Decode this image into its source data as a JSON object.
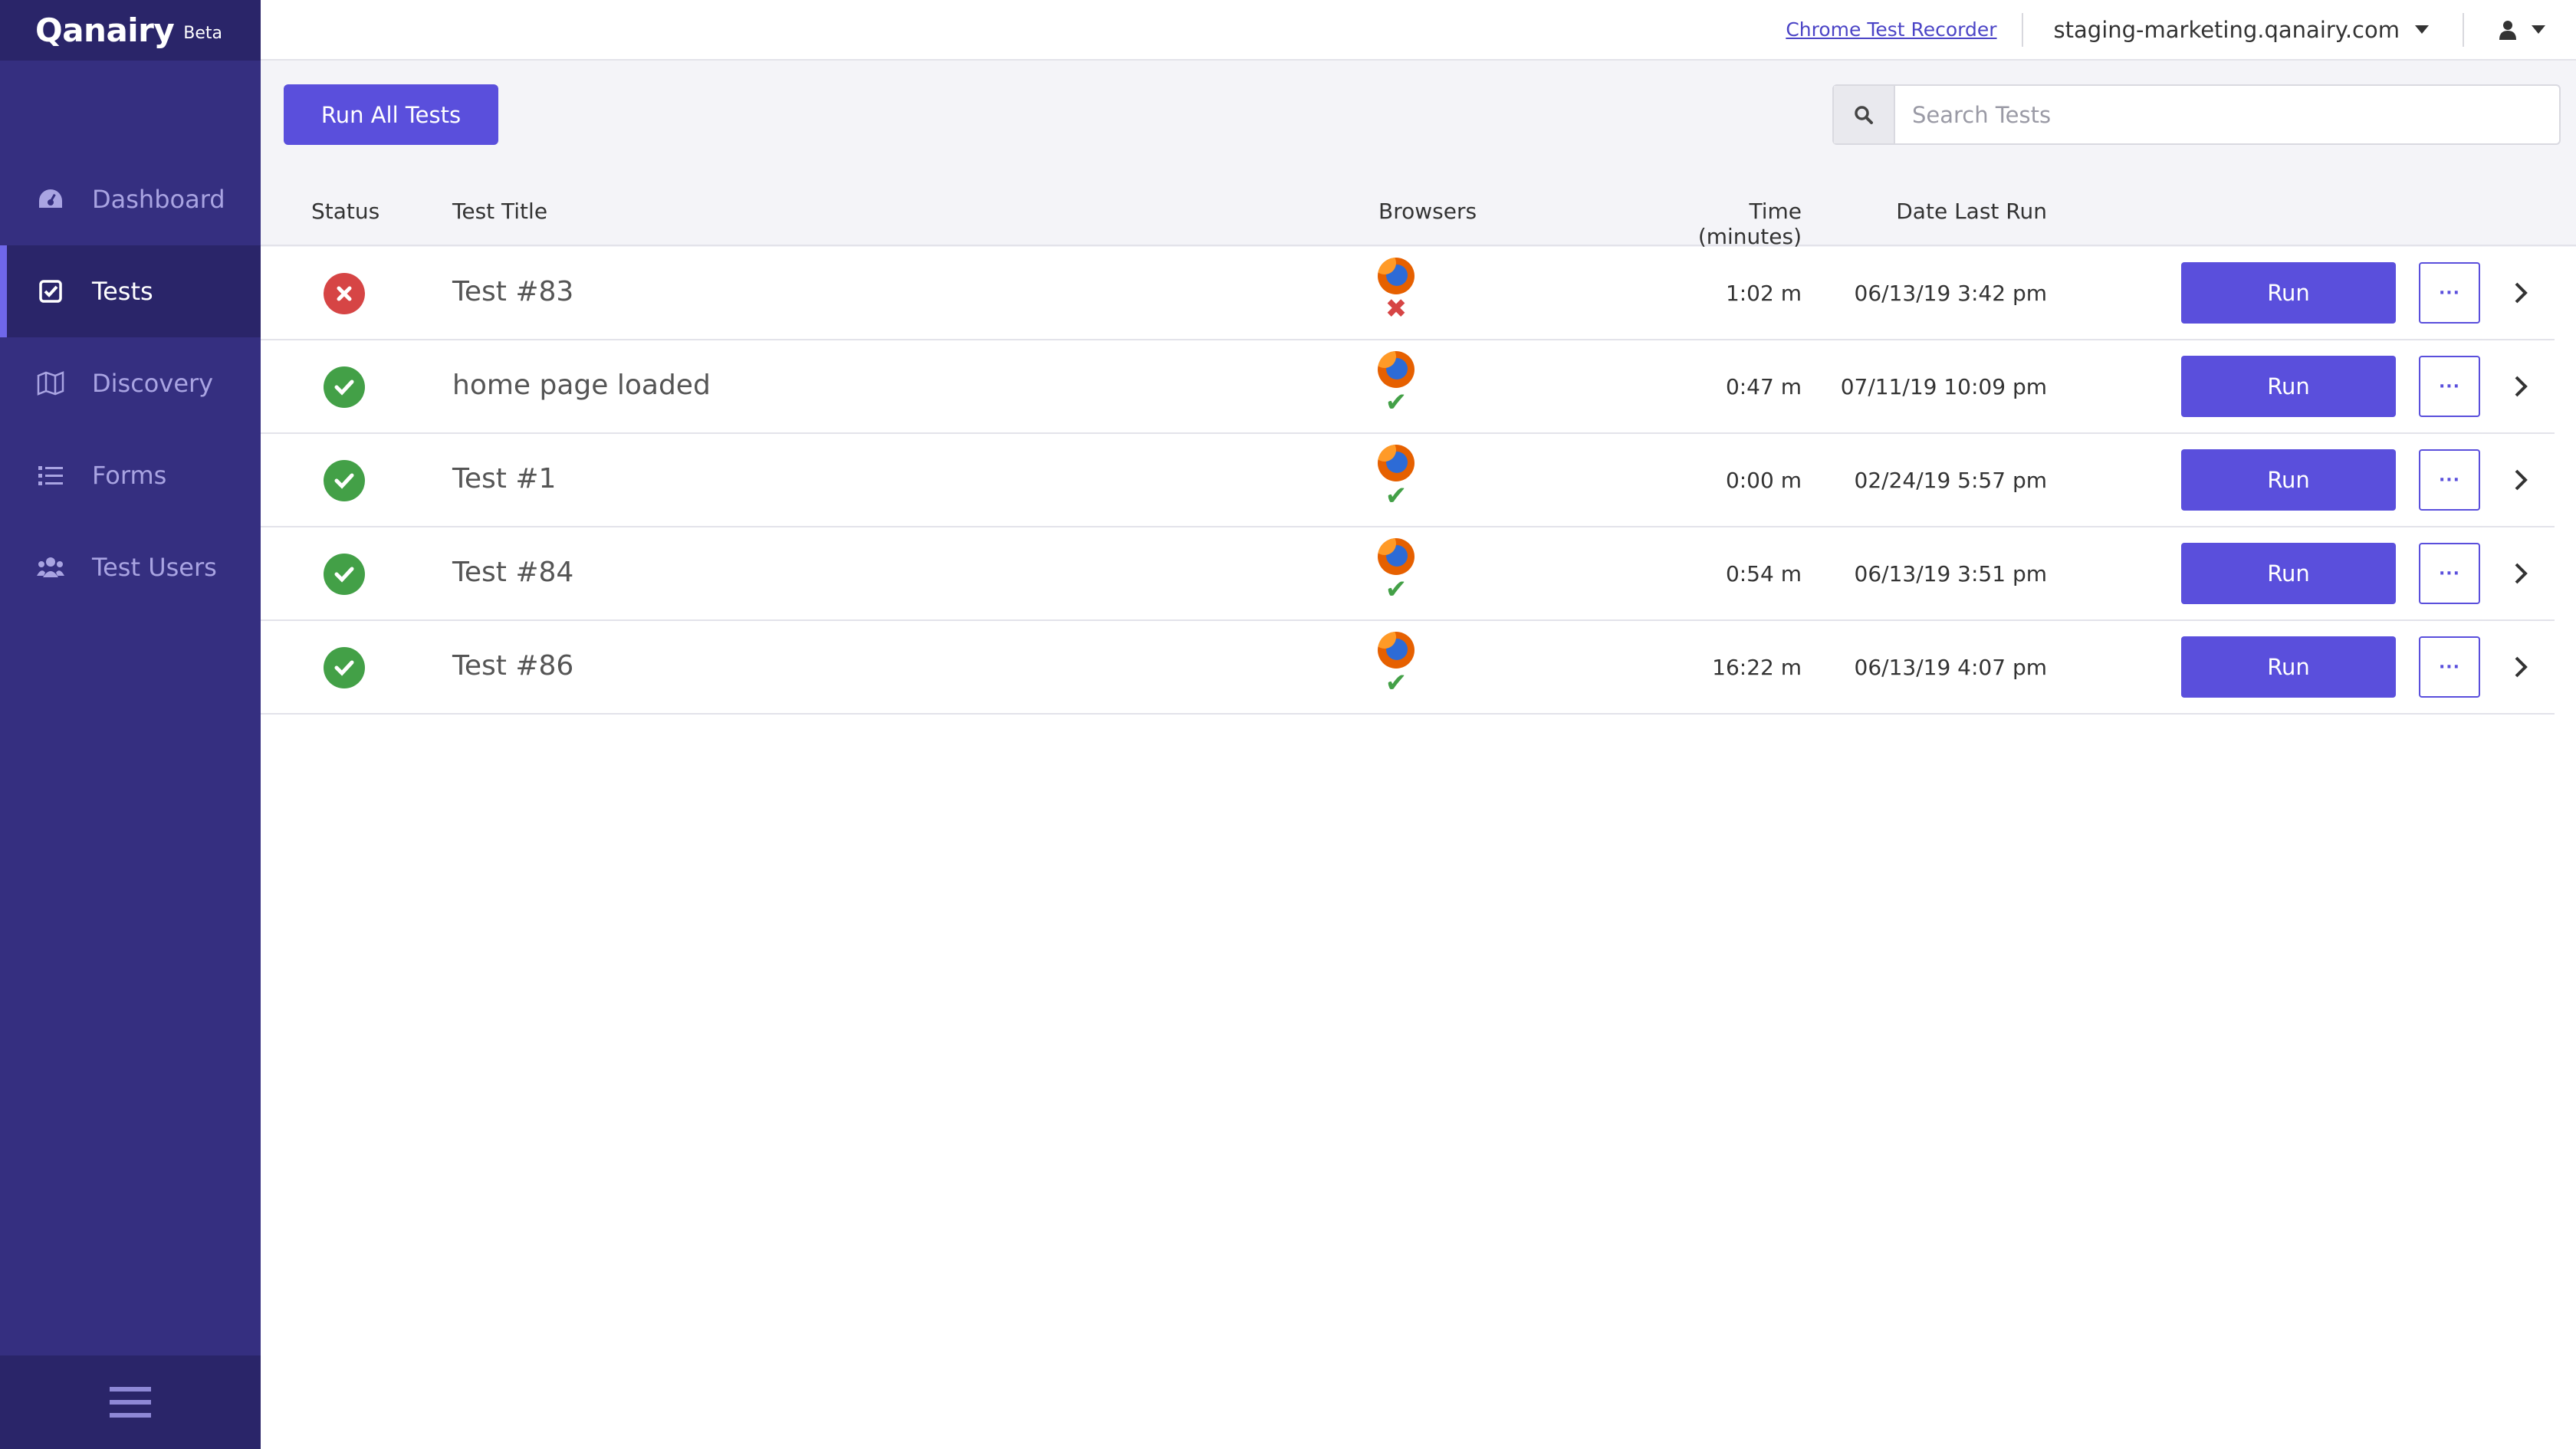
{
  "brand": {
    "name": "Qanairy",
    "badge": "Beta"
  },
  "sidebar": {
    "items": [
      {
        "label": "Dashboard",
        "icon": "dashboard-icon",
        "active": false
      },
      {
        "label": "Tests",
        "icon": "checkbox-icon",
        "active": true
      },
      {
        "label": "Discovery",
        "icon": "map-icon",
        "active": false
      },
      {
        "label": "Forms",
        "icon": "list-icon",
        "active": false
      },
      {
        "label": "Test Users",
        "icon": "users-icon",
        "active": false
      }
    ],
    "footer_icon": "hamburger-menu-icon"
  },
  "topbar": {
    "recorder_link": "Chrome Test Recorder",
    "environment": "staging-marketing.qanairy.com",
    "user_icon": "user-icon"
  },
  "toolbar": {
    "run_all_label": "Run All Tests",
    "search_placeholder": "Search Tests",
    "search_value": ""
  },
  "table": {
    "headers": {
      "status": "Status",
      "title": "Test Title",
      "browsers": "Browsers",
      "time": "Time (minutes)",
      "date": "Date Last Run"
    },
    "rows": [
      {
        "status": "fail",
        "title": "Test #83",
        "browser": "firefox",
        "browser_status": "fail",
        "time": "1:02 m",
        "date": "06/13/19 3:42 pm",
        "run_label": "Run",
        "more_label": "···"
      },
      {
        "status": "pass",
        "title": "home page loaded",
        "browser": "firefox",
        "browser_status": "pass",
        "time": "0:47 m",
        "date": "07/11/19 10:09 pm",
        "run_label": "Run",
        "more_label": "···"
      },
      {
        "status": "pass",
        "title": "Test #1",
        "browser": "firefox",
        "browser_status": "pass",
        "time": "0:00 m",
        "date": "02/24/19 5:57 pm",
        "run_label": "Run",
        "more_label": "···"
      },
      {
        "status": "pass",
        "title": "Test #84",
        "browser": "firefox",
        "browser_status": "pass",
        "time": "0:54 m",
        "date": "06/13/19 3:51 pm",
        "run_label": "Run",
        "more_label": "···"
      },
      {
        "status": "pass",
        "title": "Test #86",
        "browser": "firefox",
        "browser_status": "pass",
        "time": "16:22 m",
        "date": "06/13/19 4:07 pm",
        "run_label": "Run",
        "more_label": "···"
      }
    ]
  },
  "colors": {
    "sidebar": "#352f80",
    "sidebar_dark": "#2a2569",
    "accent": "#5a4fdc",
    "pass": "#43a047",
    "fail": "#d64545"
  }
}
